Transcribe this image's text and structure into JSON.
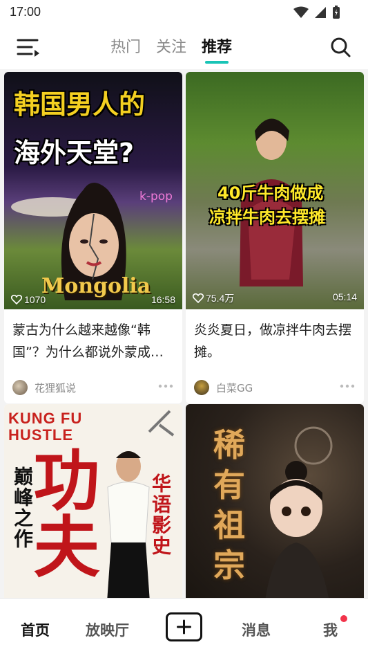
{
  "status": {
    "time": "17:00"
  },
  "top_nav": {
    "tabs": [
      {
        "label": "热门"
      },
      {
        "label": "关注"
      },
      {
        "label": "推荐"
      }
    ],
    "active_tab": "推荐",
    "accent_color": "#19c4b6"
  },
  "feed": {
    "cards": [
      {
        "cover_text_lines": [
          "韩国男人的",
          "海外天堂?"
        ],
        "cover_caption": "Mongolia",
        "cover_badge": "k-pop",
        "likes": "1070",
        "duration": "16:58",
        "title": "蒙古为什么越来越像“韩国”？为什么都说外蒙成…",
        "author": "花狸狐说"
      },
      {
        "cover_text_lines": [
          "40斤牛肉做成",
          "凉拌牛肉去摆摊"
        ],
        "likes": "75.4万",
        "duration": "05:14",
        "title": "炎炎夏日，做凉拌牛肉去摆摊。",
        "author": "白菜GG"
      },
      {
        "cover_text_lines": [
          "KUNG FU",
          "HUSTLE"
        ],
        "cover_vertical_left": "巅峰之作",
        "cover_big": "功夫",
        "cover_vertical_right": "华语影史"
      },
      {
        "cover_text_lines": [
          "稀",
          "有",
          "祖",
          "宗"
        ]
      }
    ]
  },
  "bottom_nav": {
    "home": "首页",
    "cinema": "放映厅",
    "messages": "消息",
    "me": "我"
  },
  "icons": {
    "menu": "menu-icon",
    "search": "search-icon",
    "add": "plus-icon",
    "like": "heart-icon",
    "more": "more-dots-icon"
  }
}
